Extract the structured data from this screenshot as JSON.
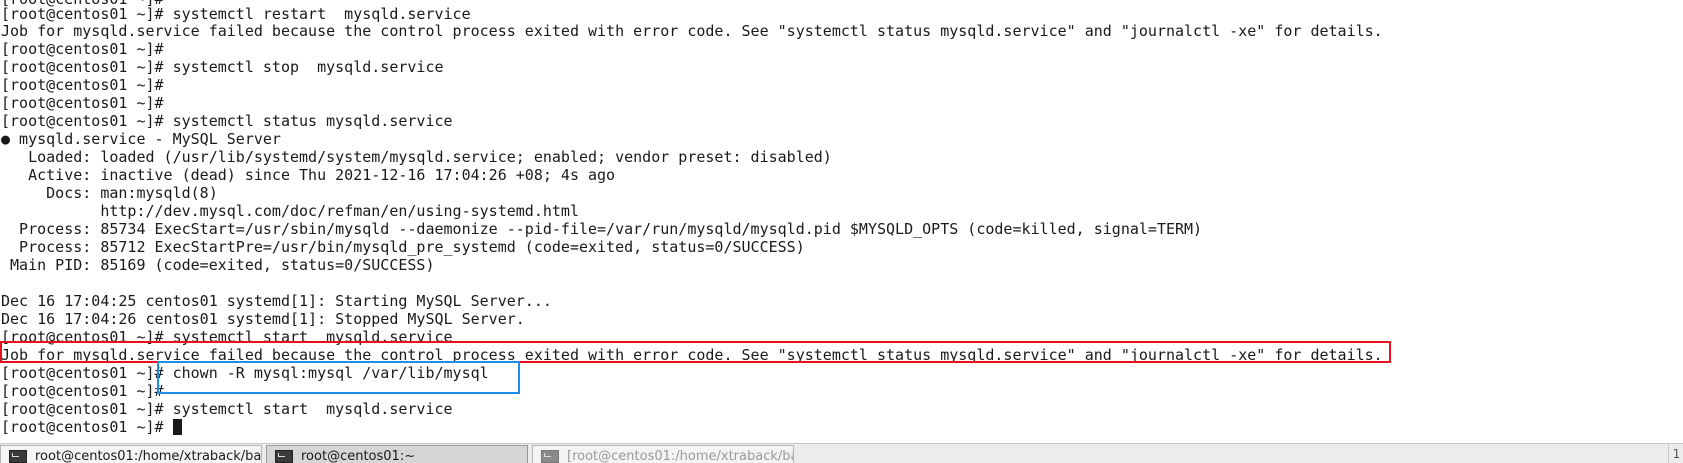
{
  "terminal": {
    "lines": [
      "[root@centos01 ~]# ",
      "[root@centos01 ~]# systemctl restart  mysqld.service",
      "Job for mysqld.service failed because the control process exited with error code. See \"systemctl status mysqld.service\" and \"journalctl -xe\" for details.",
      "[root@centos01 ~]# ",
      "[root@centos01 ~]# systemctl stop  mysqld.service",
      "[root@centos01 ~]# ",
      "[root@centos01 ~]# ",
      "[root@centos01 ~]# systemctl status mysqld.service",
      "● mysqld.service - MySQL Server",
      "   Loaded: loaded (/usr/lib/systemd/system/mysqld.service; enabled; vendor preset: disabled)",
      "   Active: inactive (dead) since Thu 2021-12-16 17:04:26 +08; 4s ago",
      "     Docs: man:mysqld(8)",
      "           http://dev.mysql.com/doc/refman/en/using-systemd.html",
      "  Process: 85734 ExecStart=/usr/sbin/mysqld --daemonize --pid-file=/var/run/mysqld/mysqld.pid $MYSQLD_OPTS (code=killed, signal=TERM)",
      "  Process: 85712 ExecStartPre=/usr/bin/mysqld_pre_systemd (code=exited, status=0/SUCCESS)",
      " Main PID: 85169 (code=exited, status=0/SUCCESS)",
      "",
      "Dec 16 17:04:25 centos01 systemd[1]: Starting MySQL Server...",
      "Dec 16 17:04:26 centos01 systemd[1]: Stopped MySQL Server.",
      "[root@centos01 ~]# systemctl start  mysqld.service",
      "Job for mysqld.service failed because the control process exited with error code. See \"systemctl status mysqld.service\" and \"journalctl -xe\" for details.",
      "[root@centos01 ~]# chown -R mysql:mysql /var/lib/mysql",
      "[root@centos01 ~]# ",
      "[root@centos01 ~]# systemctl start  mysqld.service",
      "[root@centos01 ~]# "
    ]
  },
  "taskbar": {
    "tasks": [
      {
        "label": "root@centos01:/home/xtraback/ba",
        "icon": "terminal-icon",
        "state": "normal"
      },
      {
        "label": "root@centos01:~",
        "icon": "terminal-icon",
        "state": "active"
      },
      {
        "label": "[root@centos01:/home/xtraback/ba",
        "icon": "terminal-icon",
        "state": "dim"
      }
    ],
    "tray_text": "1"
  },
  "colors": {
    "background": "#ffffff",
    "text": "#1a1a1a",
    "highlight_red": "#e8101a",
    "highlight_blue": "#1f8fe6",
    "taskbar": "#ececec"
  }
}
